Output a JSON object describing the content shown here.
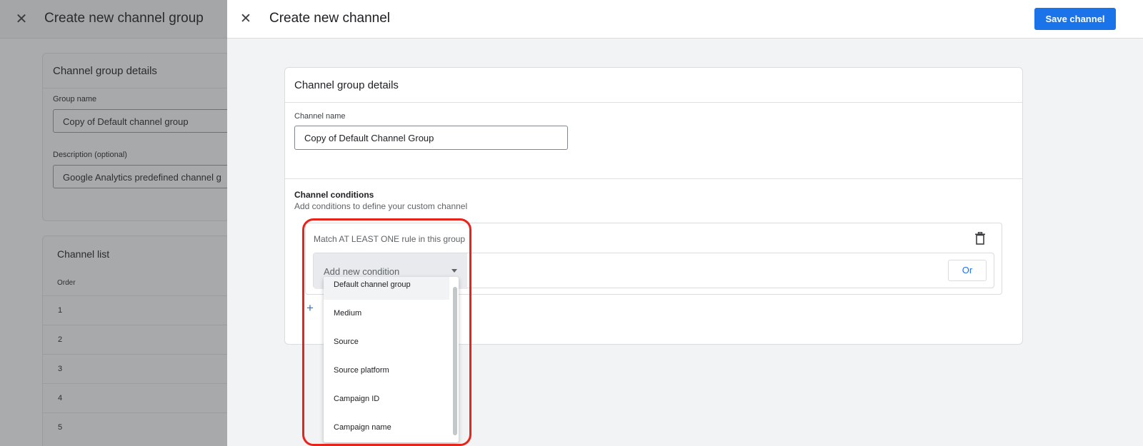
{
  "background": {
    "title": "Create new channel group",
    "details_card": {
      "title": "Channel group details",
      "group_name_label": "Group name",
      "group_name_value": "Copy of Default channel group",
      "description_label": "Description (optional)",
      "description_value": "Google Analytics predefined channel g"
    },
    "channel_list": {
      "title": "Channel list",
      "order_header": "Order",
      "rows": [
        "1",
        "2",
        "3",
        "4",
        "5"
      ]
    }
  },
  "drawer": {
    "title": "Create new channel",
    "save_label": "Save channel",
    "card_title": "Channel group details",
    "channel_name_label": "Channel name",
    "channel_name_value": "Copy of Default Channel Group",
    "conditions_title": "Channel conditions",
    "conditions_subtitle": "Add conditions to define your custom channel",
    "rule_group_label": "Match AT LEAST ONE rule in this group",
    "select_placeholder": "Add new condition",
    "or_label": "Or",
    "add_plus": "+"
  },
  "dropdown": {
    "items": [
      "Default channel group",
      "Medium",
      "Source",
      "Source platform",
      "Campaign ID",
      "Campaign name"
    ]
  },
  "colors": {
    "accent": "#1a73e8",
    "highlight": "#e8231a"
  }
}
